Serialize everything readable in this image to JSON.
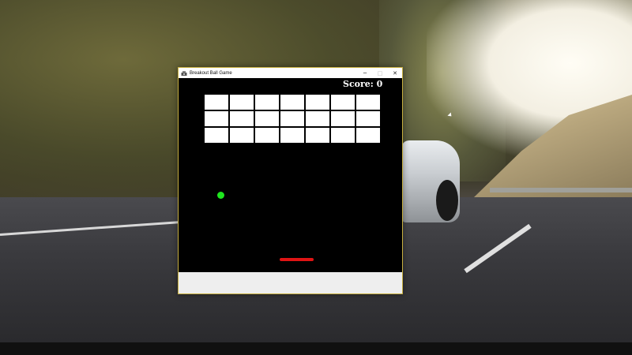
{
  "window": {
    "title": "Breakout Ball Game",
    "app_icon": "game-icon",
    "controls": {
      "minimize": "─",
      "maximize": "□",
      "close": "✕"
    }
  },
  "game": {
    "score_text": "Score: 0",
    "score": 0,
    "bricks": {
      "rows": 3,
      "columns": 7,
      "count": 21,
      "color": "#ffffff"
    },
    "ball_color": "#1ee61e",
    "paddle_color": "#e01414",
    "background_color": "#000000"
  },
  "desktop": {
    "wallpaper": "sports car on mountain road"
  }
}
